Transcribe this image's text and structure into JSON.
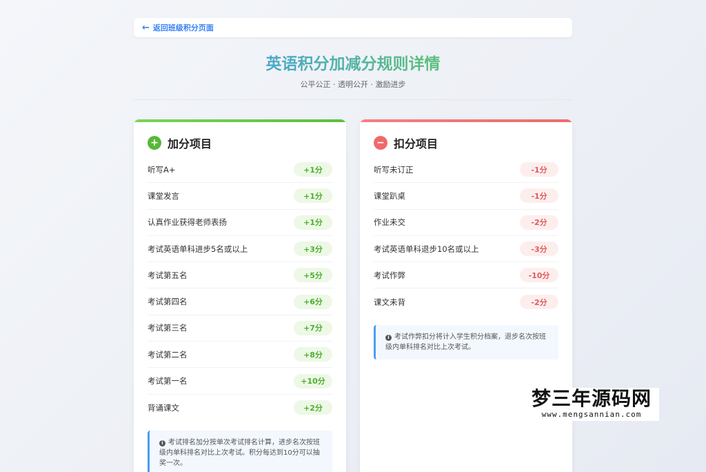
{
  "back": {
    "label": "返回班级积分页面"
  },
  "header": {
    "title": "英语积分加减分规则详情",
    "subtitle": "公平公正 · 透明公开 · 激励进步"
  },
  "add": {
    "title": "加分项目",
    "items": [
      {
        "name": "听写A+",
        "points": "+1分"
      },
      {
        "name": "课堂发言",
        "points": "+1分"
      },
      {
        "name": "认真作业获得老师表扬",
        "points": "+1分"
      },
      {
        "name": "考试英语单科进步5名或以上",
        "points": "+3分"
      },
      {
        "name": "考试第五名",
        "points": "+5分"
      },
      {
        "name": "考试第四名",
        "points": "+6分"
      },
      {
        "name": "考试第三名",
        "points": "+7分"
      },
      {
        "name": "考试第二名",
        "points": "+8分"
      },
      {
        "name": "考试第一名",
        "points": "+10分"
      },
      {
        "name": "背诵课文",
        "points": "+2分"
      }
    ],
    "note": "考试排名加分按单次考试排名计算，进步名次按班级内单科排名对比上次考试。积分每达到10分可以抽奖一次。"
  },
  "minus": {
    "title": "扣分项目",
    "items": [
      {
        "name": "听写未订正",
        "points": "-1分"
      },
      {
        "name": "课堂趴桌",
        "points": "-1分"
      },
      {
        "name": "作业未交",
        "points": "-2分"
      },
      {
        "name": "考试英语单科退步10名或以上",
        "points": "-3分"
      },
      {
        "name": "考试作弊",
        "points": "-10分"
      },
      {
        "name": "课文未背",
        "points": "-2分"
      }
    ],
    "note": "考试作弊扣分将计入学生积分档案，退步名次按班级内单科排名对比上次考试。"
  },
  "watermark": {
    "main": "梦三年源码网",
    "sub": "www.mengsannian.com"
  }
}
